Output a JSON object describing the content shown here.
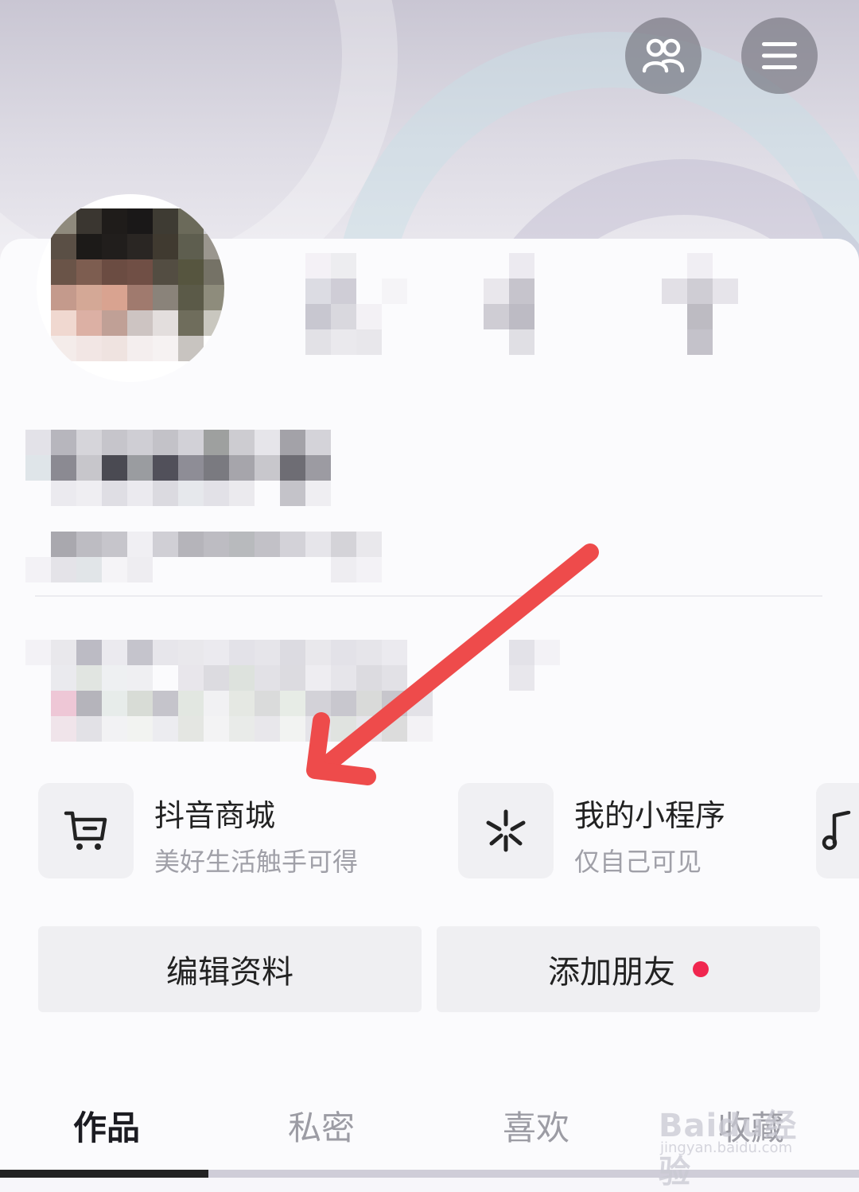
{
  "header": {
    "friends_icon": "people-icon",
    "menu_icon": "hamburger-menu-icon"
  },
  "services": [
    {
      "title": "抖音商城",
      "subtitle": "美好生活触手可得",
      "icon": "cart-icon"
    },
    {
      "title": "我的小程序",
      "subtitle": "仅自己可见",
      "icon": "mini-program-icon"
    },
    {
      "icon": "music-note-icon"
    }
  ],
  "actions": {
    "edit_profile": "编辑资料",
    "add_friends": "添加朋友"
  },
  "tabs": [
    "作品",
    "私密",
    "喜欢",
    "收藏"
  ],
  "active_tab": "作品",
  "watermark": {
    "main": "Baidu经验",
    "sub": "jingyan.baidu.com"
  },
  "colors": {
    "accent_red": "#f0264f",
    "arrow_red": "#ee4b4b"
  }
}
